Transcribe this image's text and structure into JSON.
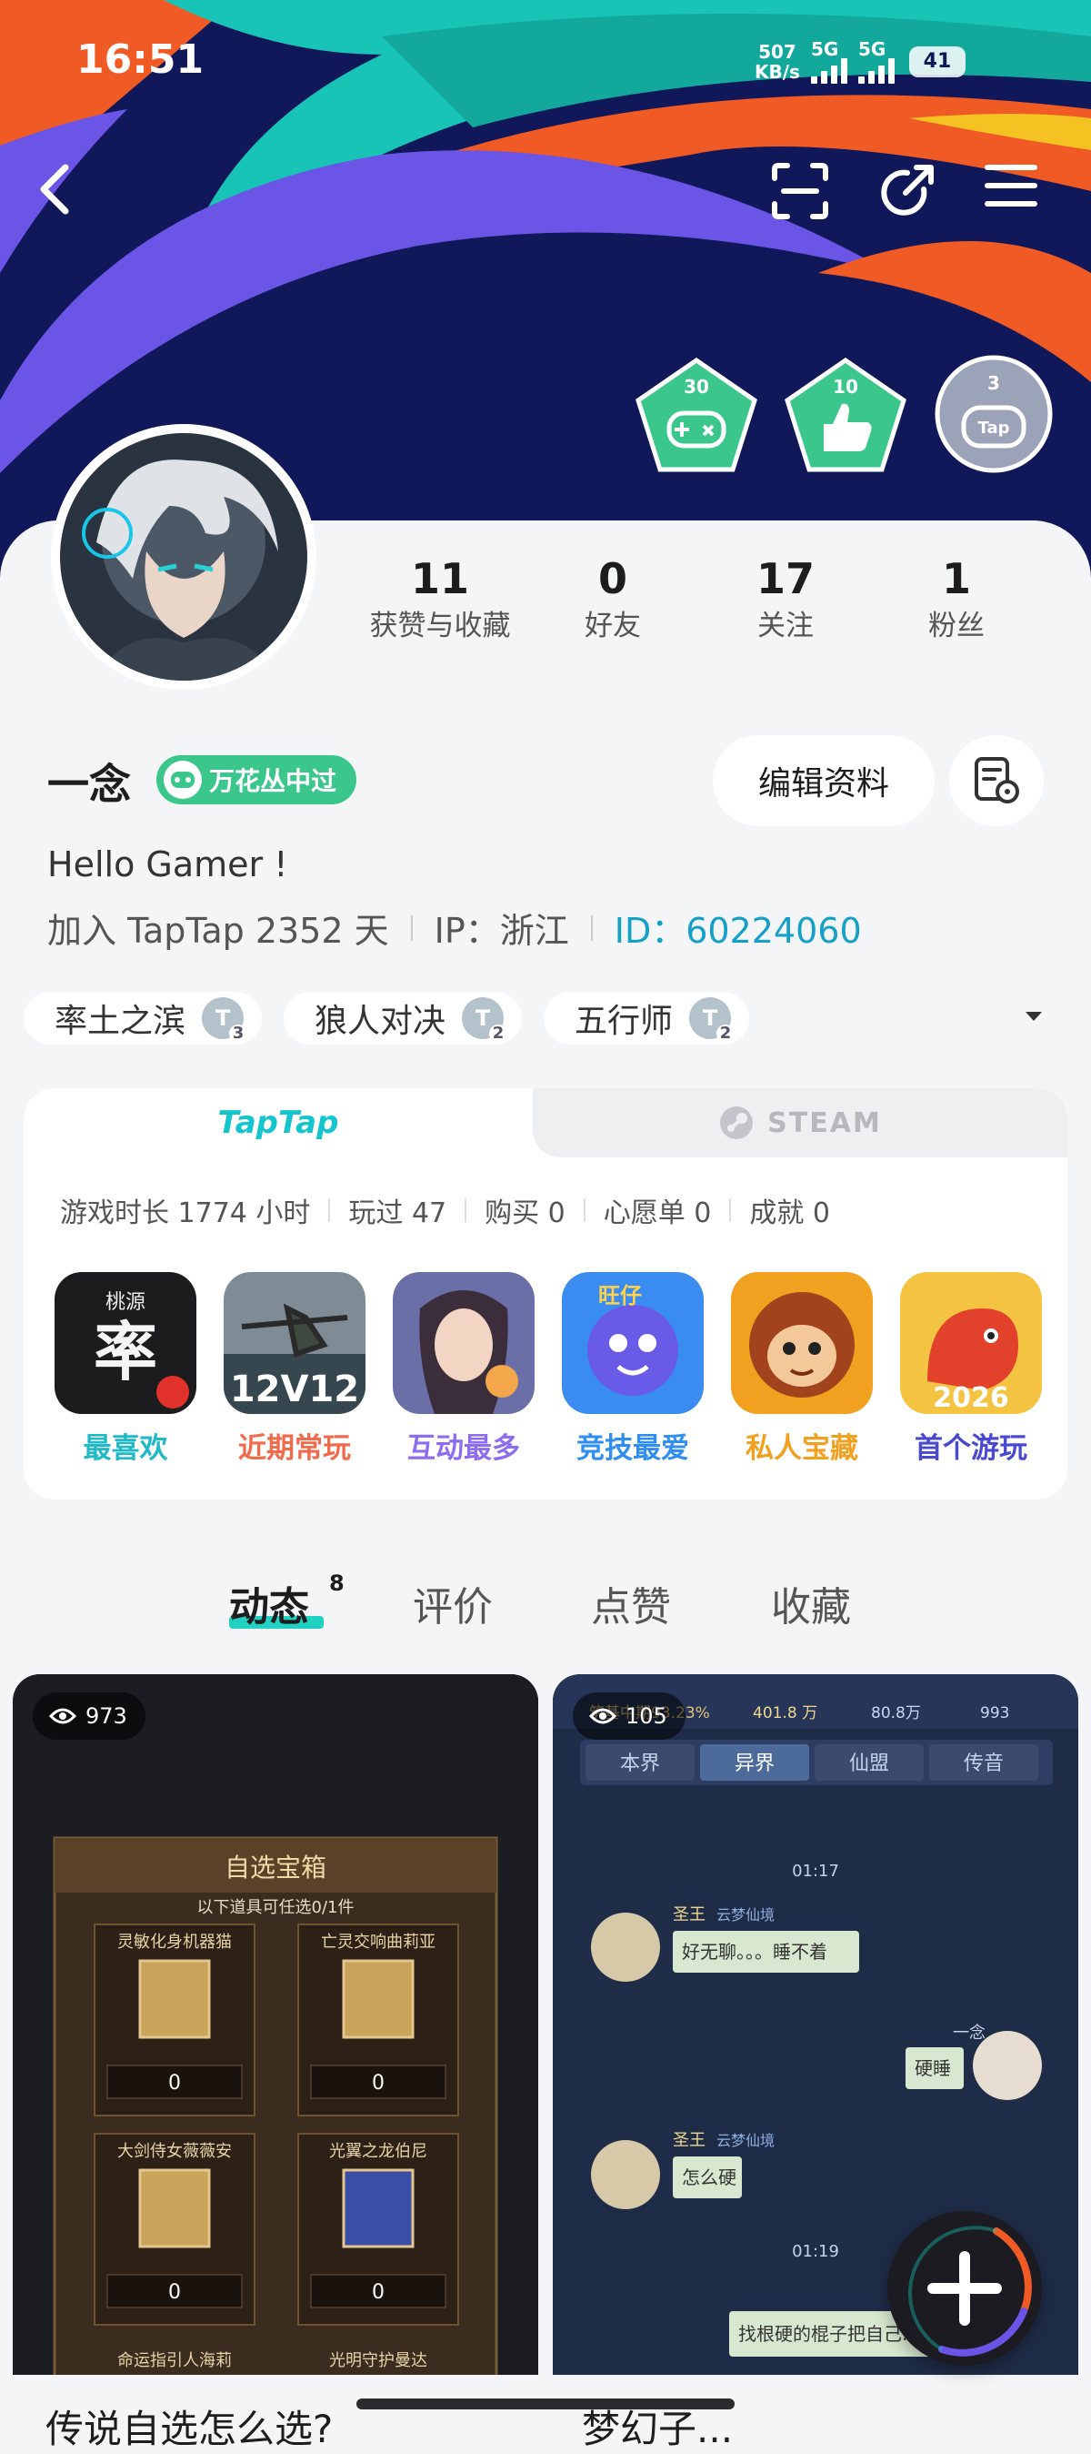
{
  "status_bar": {
    "time": "16:51",
    "speed_value": "507",
    "speed_unit": "KB/s",
    "net1": "5G",
    "net2": "5G",
    "battery": "41"
  },
  "header": {
    "achievement_badges": [
      {
        "count": "30",
        "icon": "gamepad-icon",
        "color": "#3bc78c"
      },
      {
        "count": "10",
        "icon": "thumbs-up-icon",
        "color": "#3bc78c"
      },
      {
        "count": "3",
        "icon": "tap-controller-icon",
        "color": "#9aa3b8"
      }
    ],
    "colors": {
      "banner_bg": "#11185a",
      "stripe_teal": "#17c4b6",
      "stripe_orange": "#f05a24",
      "stripe_purple": "#6a55e6"
    }
  },
  "profile": {
    "stats": [
      {
        "value": "11",
        "label": "获赞与收藏"
      },
      {
        "value": "0",
        "label": "好友"
      },
      {
        "value": "17",
        "label": "关注"
      },
      {
        "value": "1",
        "label": "粉丝"
      }
    ],
    "username": "一念",
    "level_badge": "万花丛中过",
    "edit_button": "编辑资料",
    "bio": "Hello Gamer !",
    "joined": "加入 TapTap 2352 天",
    "ip": "IP：浙江",
    "user_id": "ID：60224060",
    "tags": [
      {
        "name": "率土之滨",
        "level": "3"
      },
      {
        "name": "狼人对决",
        "level": "2"
      },
      {
        "name": "五行师",
        "level": "2"
      }
    ]
  },
  "games": {
    "tab_taptap": "TapTap",
    "tab_steam": "STEAM",
    "stats": [
      "游戏时长 1774 小时",
      "玩过 47",
      "购买 0",
      "心愿单 0",
      "成就 0"
    ],
    "items": [
      {
        "label": "最喜欢",
        "label_color": "#1fb9c8",
        "icon_text": "率",
        "icon_caption": "桃源"
      },
      {
        "label": "近期常玩",
        "label_color": "#ef6b4b",
        "icon_text": "12V12",
        "icon_caption": ""
      },
      {
        "label": "互动最多",
        "label_color": "#8c6df0",
        "icon_text": "",
        "icon_caption": ""
      },
      {
        "label": "竞技最爱",
        "label_color": "#2f8ef0",
        "icon_text": "",
        "icon_caption": "旺仔"
      },
      {
        "label": "私人宝藏",
        "label_color": "#f2a020",
        "icon_text": "",
        "icon_caption": ""
      },
      {
        "label": "首个游玩",
        "label_color": "#4a4ad0",
        "icon_text": "2026",
        "icon_caption": ""
      }
    ]
  },
  "feed": {
    "tabs": [
      "动态",
      "评价",
      "点赞",
      "收藏"
    ],
    "active_count": "8",
    "posts": [
      {
        "views": "973",
        "title": "传说自选怎么选?",
        "chest_title": "自选宝箱",
        "chest_sub": "以下道具可任选0/1件",
        "chest_items": [
          "灵敏化身机器猫",
          "亡灵交响曲莉亚",
          "大剑侍女薇薇安",
          "光翼之龙伯尼"
        ],
        "chest_footer": [
          "命运指引人海莉",
          "光明守护曼达"
        ],
        "qty": "0"
      },
      {
        "views": "105",
        "title": "梦幻子...",
        "top_stats": [
          "筑基中期93.23%",
          "401.8 万",
          "80.8万",
          "993"
        ],
        "tabs": [
          "本界",
          "异界",
          "仙盟",
          "传音"
        ],
        "time1": "01:17",
        "time2": "01:19",
        "msgs": [
          {
            "name": "圣王",
            "tag": "云梦仙境",
            "text": "好无聊。。。睡不着"
          },
          {
            "name": "一念",
            "tag": "",
            "text": "硬睡"
          },
          {
            "name": "圣王",
            "tag": "云梦仙境",
            "text": "怎么硬"
          },
          {
            "name": "",
            "tag": "",
            "text": "找根硬的棍子把自己..."
          }
        ]
      }
    ]
  }
}
